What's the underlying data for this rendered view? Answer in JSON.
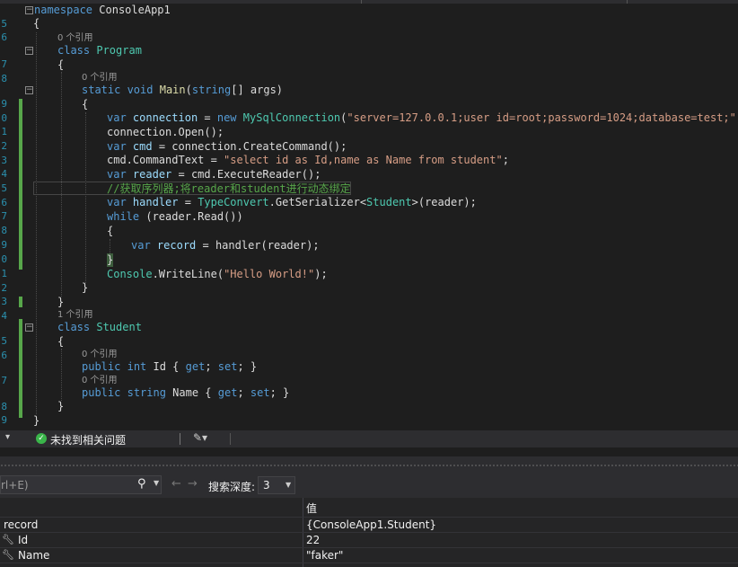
{
  "editor": {
    "line_numbers": [
      "5",
      "6",
      "",
      "7",
      "8",
      "",
      "9",
      "0",
      "1",
      "2",
      "3",
      "4",
      "5",
      "6",
      "7",
      "8",
      "9",
      "0",
      "1",
      "2",
      "3",
      "4",
      "",
      "5",
      "6",
      "",
      "7",
      "",
      "8",
      "9",
      "0"
    ],
    "code_lens": {
      "program": "0 个引用",
      "main": "0 个引用",
      "student": "1 个引用",
      "id": "0 个引用",
      "name": "0 个引用"
    },
    "code": {
      "namespace_kw": "namespace",
      "namespace_name": "ConsoleApp1",
      "open_brace": "{",
      "close_brace": "}",
      "class_kw": "class",
      "program": "Program",
      "static_void": "static void",
      "main": "Main",
      "string_arr": "string",
      "main_args": "[] args)",
      "main_paren": "(",
      "var": "var",
      "connection": "connection",
      "eq_new": " = ",
      "new": "new",
      "mysqlconn": "MySqlConnection",
      "conn_string": "\"server=127.0.0.1;user id=root;password=1024;database=test;\"",
      "conn_tail": ");",
      "open_line": "connection.Open();",
      "cmd": "cmd",
      "create_cmd": " = connection.CreateCommand();",
      "cmd_text": "cmd.CommandText = ",
      "sql": "\"select id as Id,name as Name from student\"",
      "semi": ";",
      "reader": "reader",
      "exec_reader": " = cmd.ExecuteReader();",
      "comment": "//获取序列器;将reader和student进行动态绑定",
      "handler": "handler",
      "type_convert": "TypeConvert",
      "get_serializer": ".GetSerializer<",
      "student": "Student",
      "serializer_tail": ">(reader);",
      "while": "while",
      "while_cond": " (reader.Read())",
      "record": "record",
      "record_tail": " = handler(reader);",
      "console": "Console",
      "writeline": ".WriteLine(",
      "hello": "\"Hello World!\"",
      "public": "public",
      "int": "int",
      "id_prop": " Id { ",
      "get_kw": "get",
      "set_kw": "set",
      "prop_tail": "; }",
      "string_kw": "string",
      "name_prop": " Name { "
    }
  },
  "statusbar": {
    "message": "未找到相关问题"
  },
  "toolbar": {
    "search_placeholder": "rl+E)",
    "depth_label": "搜索深度:",
    "depth_value": "3"
  },
  "watch": {
    "value_header": "值",
    "rows": [
      {
        "name": "record",
        "value": "{ConsoleApp1.Student}"
      },
      {
        "name": "Id",
        "value": "22"
      },
      {
        "name": "Name",
        "value": "\"faker\""
      }
    ]
  },
  "colors": {
    "keyword": "#569cd6",
    "type": "#4ec9b0",
    "string": "#d69d85",
    "comment": "#57a64a",
    "method": "#dcdcaa",
    "background": "#1e1e1e"
  }
}
